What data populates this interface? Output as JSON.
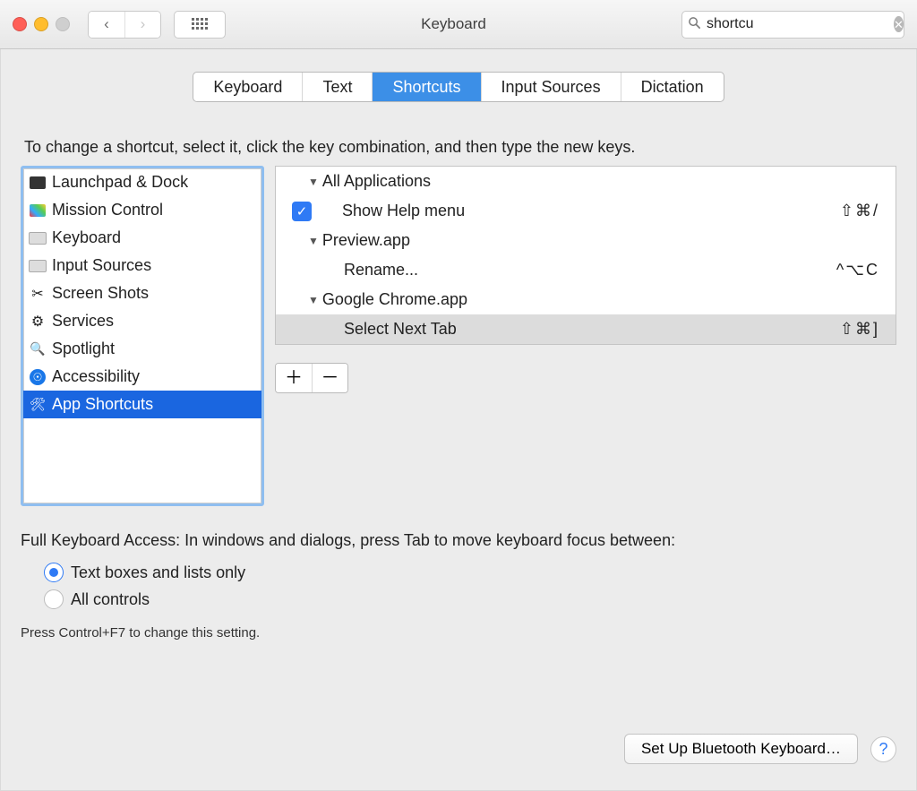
{
  "titlebar": {
    "title": "Keyboard",
    "search_value": "shortcu"
  },
  "tabs": [
    "Keyboard",
    "Text",
    "Shortcuts",
    "Input Sources",
    "Dictation"
  ],
  "active_tab_index": 2,
  "instructions": "To change a shortcut, select it, click the key combination, and then type the new keys.",
  "sidebar_items": [
    "Launchpad & Dock",
    "Mission Control",
    "Keyboard",
    "Input Sources",
    "Screen Shots",
    "Services",
    "Spotlight",
    "Accessibility",
    "App Shortcuts"
  ],
  "sidebar_selected_index": 8,
  "groups": [
    {
      "name": "All Applications",
      "items": [
        {
          "label": "Show Help menu",
          "keys": "⇧⌘/",
          "checked": true
        }
      ]
    },
    {
      "name": "Preview.app",
      "items": [
        {
          "label": "Rename...",
          "keys": "^⌥C",
          "checked": null
        }
      ]
    },
    {
      "name": "Google Chrome.app",
      "items": [
        {
          "label": "Select Next Tab",
          "keys": "⇧⌘]",
          "checked": null,
          "selected": true
        }
      ]
    }
  ],
  "full_access": {
    "label": "Full Keyboard Access: In windows and dialogs, press Tab to move keyboard focus between:",
    "options": [
      "Text boxes and lists only",
      "All controls"
    ],
    "selected_index": 0,
    "hint": "Press Control+F7 to change this setting."
  },
  "footer_button": "Set Up Bluetooth Keyboard…"
}
